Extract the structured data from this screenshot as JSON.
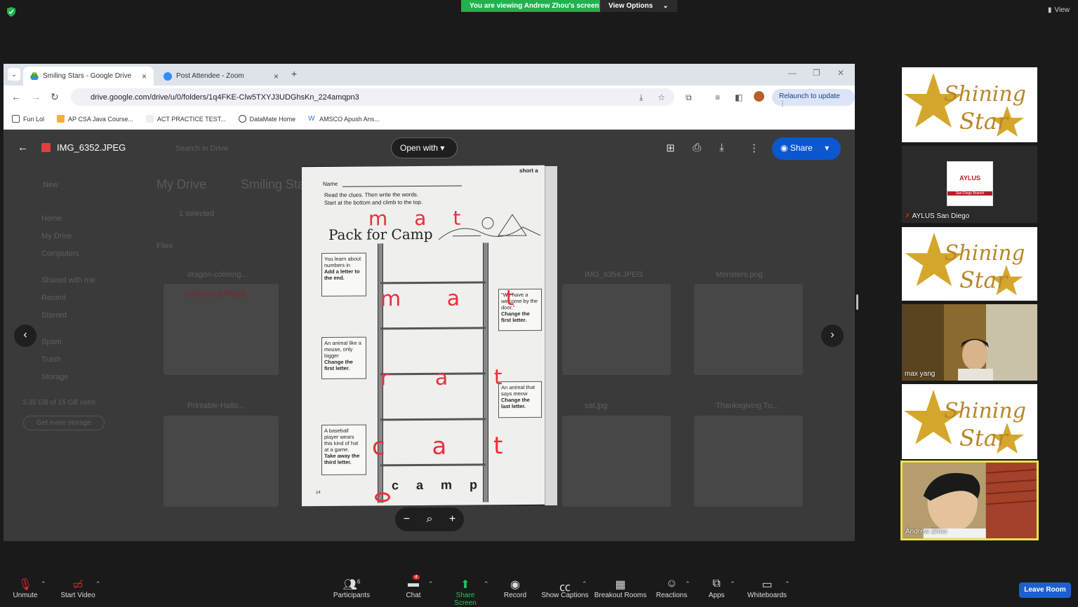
{
  "zoom_top": {
    "banner": "You are viewing Andrew Zhou's screen",
    "view_options": "View Options",
    "view": "View"
  },
  "browser": {
    "tabs": [
      {
        "label": "Smiling Stars - Google Drive"
      },
      {
        "label": "Post Attendee - Zoom"
      }
    ],
    "url": "drive.google.com/drive/u/0/folders/1q4FKE-Clw5TXYJ3UDGhsKn_224amqpn3",
    "relaunch": "Relaunch to update",
    "bookmarks": [
      "Fun Lol",
      "AP CSA Java Course...",
      "ACT PRACTICE TEST...",
      "DataMate Home",
      "AMSCO Apush Ans..."
    ]
  },
  "drive": {
    "file_name": "IMG_6352.JPEG",
    "search_placeholder": "Search in Drive",
    "open_with": "Open with",
    "share": "Share",
    "breadcrumb_root": "My Drive",
    "breadcrumb_folder": "Smiling Sta",
    "selected": "1 selected",
    "files_label": "Files",
    "new_label": "New",
    "nav": [
      "Home",
      "My Drive",
      "Computers",
      "Shared with me",
      "Recent",
      "Starred",
      "Spam",
      "Trash",
      "Storage"
    ],
    "storage_text": "3.35 GB of 15 GB used",
    "get_storage": "Get more storage",
    "files": [
      "dragon-coloring...",
      "IMG_6354.JPEG",
      "Monsters.png",
      "Printable-Hallo...",
      "sat.jpg",
      "Thanksgiving Tu..."
    ],
    "coloring_text": "Coloring Page"
  },
  "worksheet": {
    "name_label": "Name",
    "corner": "short a",
    "instructions_1": "Read the clues. Then write the words.",
    "instructions_2": "Start at the bottom and climb to the top.",
    "title": "Pack for Camp",
    "clue1": "You learn about numbers in",
    "clue1_bold": "Add a letter to the end.",
    "clue2": "\"We have a welcome by the door.\"",
    "clue2_bold": "Change the first letter.",
    "clue3": "An animal like a mouse, only bigger",
    "clue3_bold": "Change the first letter.",
    "clue4": "An animal that says meow",
    "clue4_bold": "Change the last letter.",
    "clue5": "A baseball player wears this kind of hat at a game.",
    "clue5_bold": "Take away the third letter.",
    "start_word": "c a m p",
    "page_num": "14",
    "written": [
      "mat",
      "m a t",
      "r a t",
      "c a t"
    ]
  },
  "participants": [
    {
      "name": "",
      "kind": "logo"
    },
    {
      "name": "AYLUS San Diego",
      "kind": "aylus"
    },
    {
      "name": "",
      "kind": "logo"
    },
    {
      "name": "max yang",
      "kind": "video"
    },
    {
      "name": "",
      "kind": "logo"
    },
    {
      "name": "Andrew Zhou",
      "kind": "video"
    }
  ],
  "logo_text_1": "Shining",
  "logo_text_2": "Star",
  "aylus_logo": "AYLUS",
  "aylus_sub": "San Diego Branch",
  "toolbar": {
    "unmute": "Unmute",
    "start_video": "Start Video",
    "participants": "Participants",
    "participants_count": "6",
    "chat": "Chat",
    "chat_badge": "4",
    "share_screen": "Share Screen",
    "record": "Record",
    "show_captions": "Show Captions",
    "breakout_rooms": "Breakout Rooms",
    "reactions": "Reactions",
    "apps": "Apps",
    "whiteboards": "Whiteboards",
    "leave_room": "Leave Room"
  },
  "colors": {
    "zoom_green": "#22b14c",
    "drive_blue": "#0b57d0",
    "pen_red": "#e8303a",
    "logo_gold": "#d4a72c"
  }
}
